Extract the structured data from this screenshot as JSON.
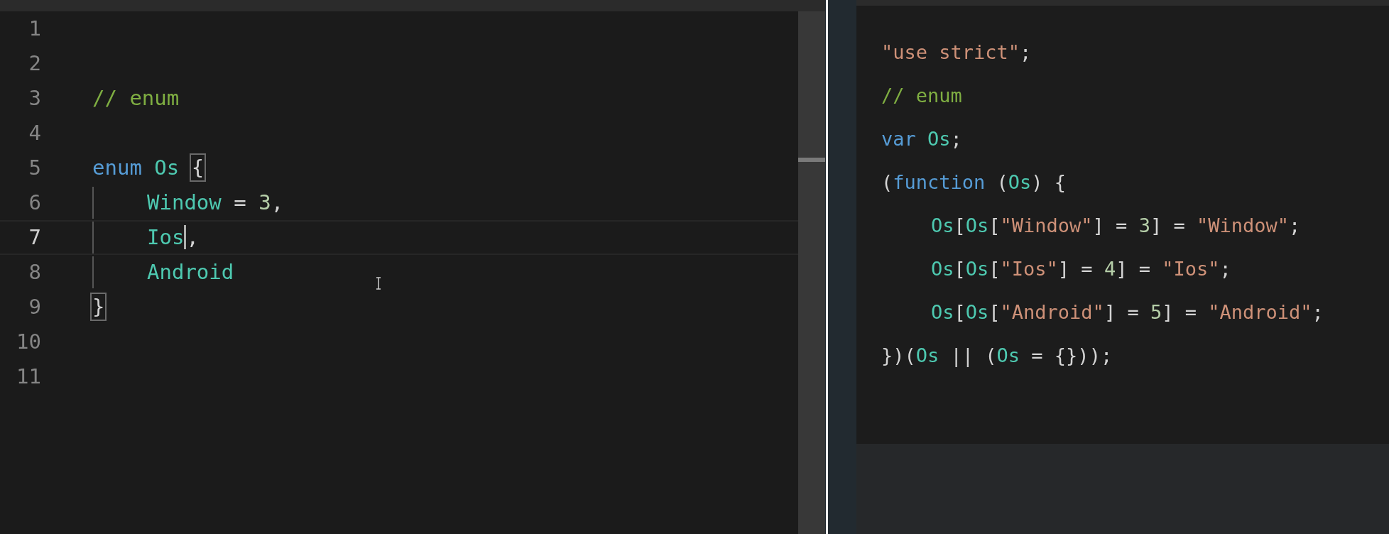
{
  "editor": {
    "lines": [
      {
        "number": "1",
        "current": false,
        "indented": false
      },
      {
        "number": "2",
        "current": false,
        "indented": false
      },
      {
        "number": "3",
        "current": false,
        "indented": false,
        "tokens": [
          {
            "kind": "comment",
            "text": "// enum"
          }
        ]
      },
      {
        "number": "4",
        "current": false,
        "indented": false
      },
      {
        "number": "5",
        "current": false,
        "indented": false,
        "tokens": [
          {
            "kind": "keyword",
            "text": "enum"
          },
          {
            "kind": "type",
            "text": " Os "
          },
          {
            "kind": "punct",
            "text": "{",
            "matched": true
          }
        ]
      },
      {
        "number": "6",
        "current": false,
        "indented": true,
        "tokens": [
          {
            "kind": "type",
            "text": "Window"
          },
          {
            "kind": "punct",
            "text": " = "
          },
          {
            "kind": "number",
            "text": "3"
          },
          {
            "kind": "punct",
            "text": ","
          }
        ]
      },
      {
        "number": "7",
        "current": true,
        "indented": true,
        "tokens": [
          {
            "kind": "type",
            "text": "Ios",
            "caret": true
          },
          {
            "kind": "punct",
            "text": ","
          }
        ]
      },
      {
        "number": "8",
        "current": false,
        "indented": true,
        "tokens": [
          {
            "kind": "type",
            "text": "Android"
          }
        ]
      },
      {
        "number": "9",
        "current": false,
        "indented": false,
        "tokens": [
          {
            "kind": "punct",
            "text": "}",
            "matched": true
          }
        ]
      },
      {
        "number": "10",
        "current": false,
        "indented": false
      },
      {
        "number": "11",
        "current": false,
        "indented": false
      }
    ]
  },
  "output": {
    "lines": [
      {
        "indented": false,
        "tokens": [
          {
            "kind": "string",
            "text": "\"use strict\""
          },
          {
            "kind": "punct",
            "text": ";"
          }
        ]
      },
      {
        "indented": false,
        "tokens": [
          {
            "kind": "comment",
            "text": "// enum"
          }
        ]
      },
      {
        "indented": false,
        "tokens": [
          {
            "kind": "keyword",
            "text": "var"
          },
          {
            "kind": "type",
            "text": " Os"
          },
          {
            "kind": "punct",
            "text": ";"
          }
        ]
      },
      {
        "indented": false,
        "tokens": [
          {
            "kind": "punct",
            "text": "("
          },
          {
            "kind": "keyword",
            "text": "function"
          },
          {
            "kind": "punct",
            "text": " ("
          },
          {
            "kind": "type",
            "text": "Os"
          },
          {
            "kind": "punct",
            "text": ") {"
          }
        ]
      },
      {
        "indented": true,
        "tokens": [
          {
            "kind": "type",
            "text": "Os"
          },
          {
            "kind": "punct",
            "text": "["
          },
          {
            "kind": "type",
            "text": "Os"
          },
          {
            "kind": "punct",
            "text": "["
          },
          {
            "kind": "string",
            "text": "\"Window\""
          },
          {
            "kind": "punct",
            "text": "] = "
          },
          {
            "kind": "number",
            "text": "3"
          },
          {
            "kind": "punct",
            "text": "] = "
          },
          {
            "kind": "string",
            "text": "\"Window\""
          },
          {
            "kind": "punct",
            "text": ";"
          }
        ]
      },
      {
        "indented": true,
        "tokens": [
          {
            "kind": "type",
            "text": "Os"
          },
          {
            "kind": "punct",
            "text": "["
          },
          {
            "kind": "type",
            "text": "Os"
          },
          {
            "kind": "punct",
            "text": "["
          },
          {
            "kind": "string",
            "text": "\"Ios\""
          },
          {
            "kind": "punct",
            "text": "] = "
          },
          {
            "kind": "number",
            "text": "4"
          },
          {
            "kind": "punct",
            "text": "] = "
          },
          {
            "kind": "string",
            "text": "\"Ios\""
          },
          {
            "kind": "punct",
            "text": ";"
          }
        ]
      },
      {
        "indented": true,
        "tokens": [
          {
            "kind": "type",
            "text": "Os"
          },
          {
            "kind": "punct",
            "text": "["
          },
          {
            "kind": "type",
            "text": "Os"
          },
          {
            "kind": "punct",
            "text": "["
          },
          {
            "kind": "string",
            "text": "\"Android\""
          },
          {
            "kind": "punct",
            "text": "] = "
          },
          {
            "kind": "number",
            "text": "5"
          },
          {
            "kind": "punct",
            "text": "] = "
          },
          {
            "kind": "string",
            "text": "\"Android\""
          },
          {
            "kind": "punct",
            "text": ";"
          }
        ]
      },
      {
        "indented": false,
        "tokens": [
          {
            "kind": "punct",
            "text": "})("
          },
          {
            "kind": "type",
            "text": "Os"
          },
          {
            "kind": "punct",
            "text": " || ("
          },
          {
            "kind": "type",
            "text": "Os"
          },
          {
            "kind": "punct",
            "text": " = {}));"
          }
        ]
      }
    ]
  }
}
